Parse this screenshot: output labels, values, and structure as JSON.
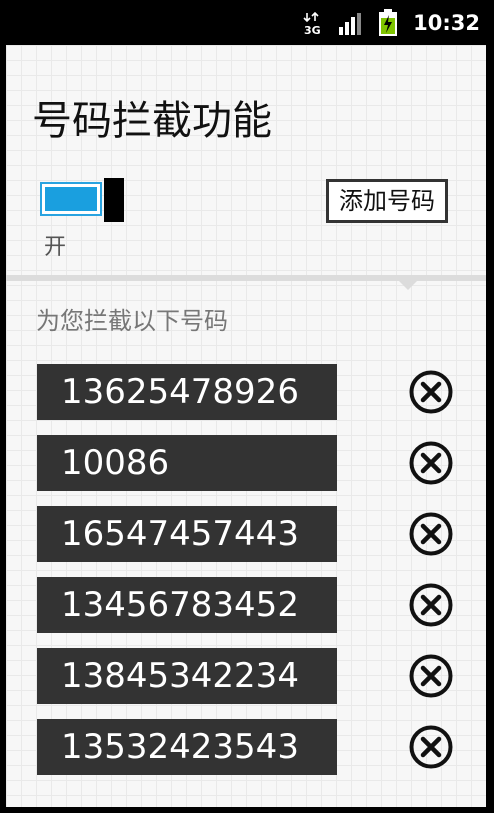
{
  "status_bar": {
    "network_icon": "3g-data-icon",
    "signal_icon": "signal-strength-icon",
    "battery_icon": "battery-charging-icon",
    "time": "10:32"
  },
  "page": {
    "title": "号码拦截功能"
  },
  "toggle": {
    "state_label": "开",
    "is_on": true
  },
  "add_button": {
    "label": "添加号码"
  },
  "list": {
    "header": "为您拦截以下号码",
    "delete_icon": "circle-x-icon",
    "numbers": [
      "13625478926",
      "10086",
      "16547457443",
      "13456783452",
      "13845342234",
      "13532423543"
    ]
  },
  "colors": {
    "accent": "#1a9fdf",
    "row_background": "#333333",
    "screen_background": "#f7f7f7"
  }
}
